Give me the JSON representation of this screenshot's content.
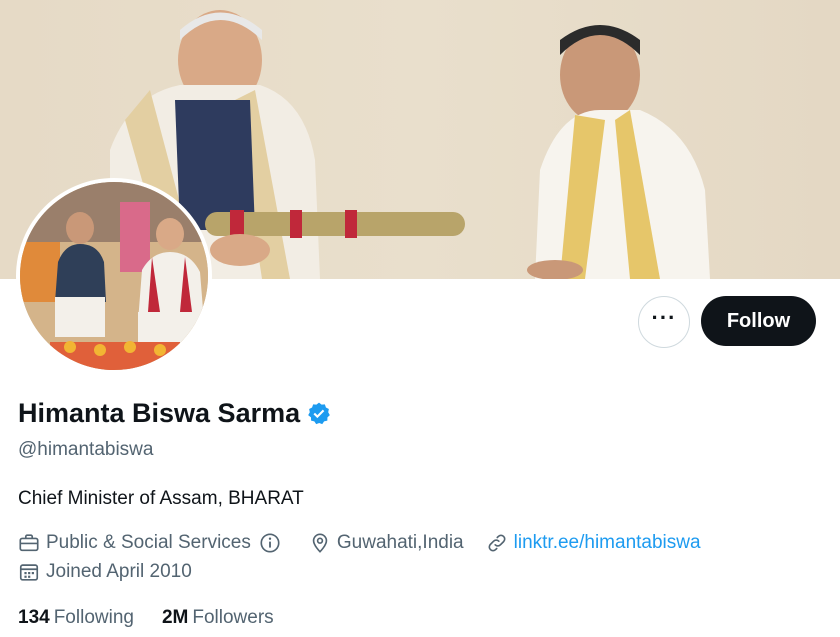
{
  "profile": {
    "name": "Himanta Biswa Sarma",
    "handle": "@himantabiswa",
    "bio": "Chief Minister of Assam, BHARAT",
    "category": "Public & Social Services",
    "location": "Guwahati,India",
    "website": "linktr.ee/himantabiswa",
    "joined": "Joined April 2010",
    "verified": true
  },
  "actions": {
    "more": "···",
    "follow": "Follow"
  },
  "stats": {
    "following_count": "134",
    "following_label": "Following",
    "followers_count": "2M",
    "followers_label": "Followers"
  },
  "icons": {
    "verified": "verified-badge-icon",
    "category": "briefcase-icon",
    "info": "info-icon",
    "location": "location-pin-icon",
    "link": "link-icon",
    "calendar": "calendar-icon"
  },
  "colors": {
    "accent": "#1d9bf0",
    "follow_bg": "#0f1419",
    "secondary_text": "#536471"
  }
}
